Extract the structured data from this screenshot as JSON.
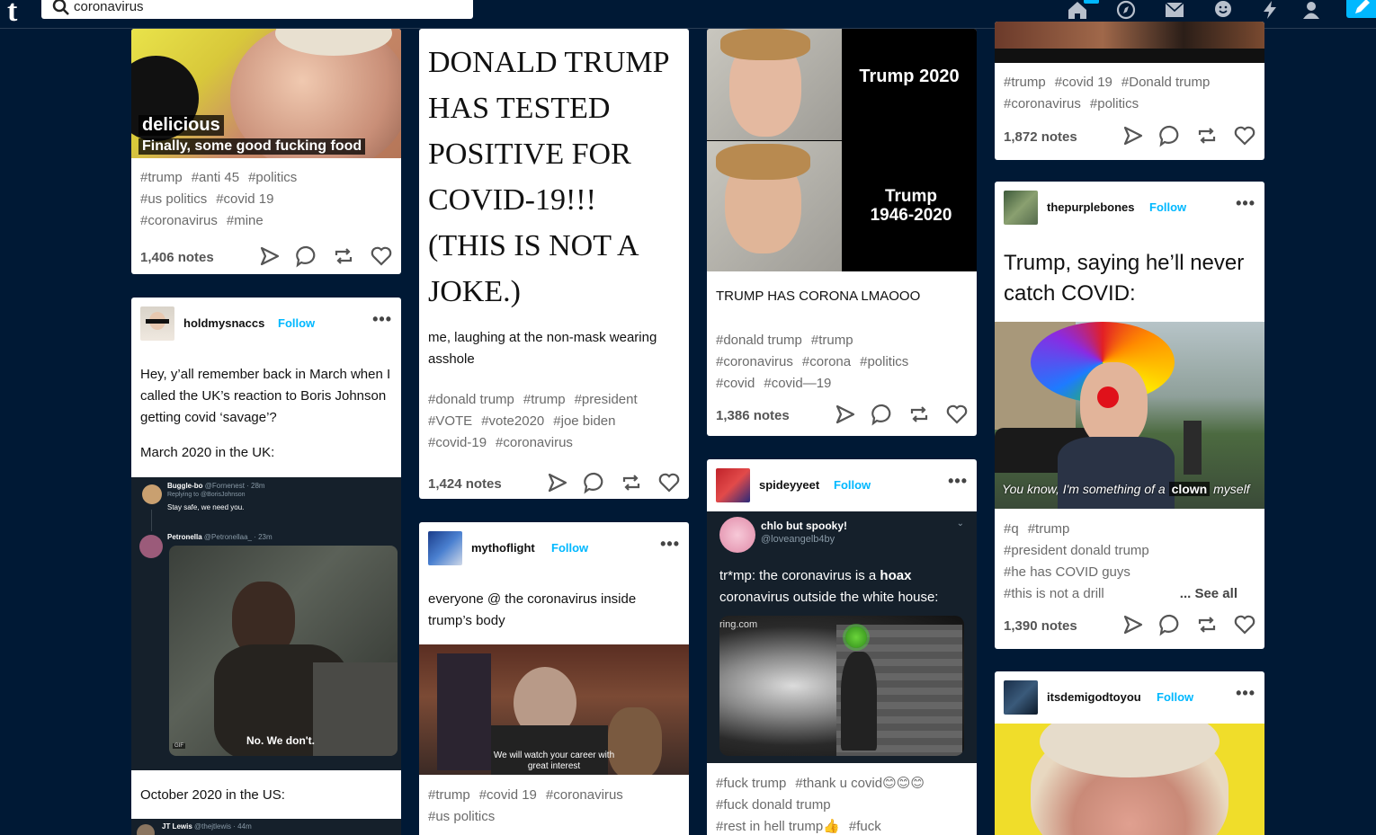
{
  "app": {
    "logo": "t",
    "search_value": "coronavirus"
  },
  "col1": {
    "post1": {
      "image_caption_1": "delicious",
      "image_caption_2": "Finally, some good fucking food",
      "tags": [
        "#trump",
        "#anti 45",
        "#politics",
        "#us politics",
        "#covid 19",
        "#coronavirus",
        "#mine"
      ],
      "notes": "1,406 notes"
    },
    "post2": {
      "username": "holdmysnaccs",
      "follow": "Follow",
      "text1": "Hey, y’all remember back in March when I called the UK’s reaction to Boris Johnson getting covid ‘savage’?",
      "text2": "March 2020 in the UK:",
      "tweet1_user": "Buggle-bo",
      "tweet1_handle": "@Fornenest · 28m",
      "tweet1_reply": "Replying to @BorisJohnson",
      "tweet1_text": "Stay safe, we need you.",
      "tweet2_user": "Petronella",
      "tweet2_handle": "@Petronellaa_ · 23m",
      "gif_caption": "No. We don't.",
      "gif_label": "GIF",
      "text3": "October 2020 in the US:",
      "tweet3_user": "JT Lewis",
      "tweet3_handle": "@thejtlewis · 44m"
    }
  },
  "col2": {
    "post1": {
      "headline": "DONALD TRUMP HAS TESTED POSITIVE FOR COVID-19!!! (THIS IS NOT A JOKE.)",
      "text": "me, laughing at the non-mask wearing asshole",
      "tags": [
        "#donald trump",
        "#trump",
        "#president",
        "#VOTE",
        "#vote2020",
        "#joe biden",
        "#covid-19",
        "#coronavirus"
      ],
      "notes": "1,424 notes"
    },
    "post2": {
      "username": "mythoflight",
      "follow": "Follow",
      "text": "everyone @ the coronavirus inside trump’s body",
      "image_caption": "We will watch your career with great interest",
      "tags": [
        "#trump",
        "#covid 19",
        "#coronavirus",
        "#us politics"
      ]
    }
  },
  "col3": {
    "post1": {
      "meme_top": "Trump 2020",
      "meme_bottom": "Trump 1946-2020",
      "text": "TRUMP HAS CORONA LMAOOO",
      "tags": [
        "#donald trump",
        "#trump",
        "#coronavirus",
        "#corona",
        "#politics",
        "#covid",
        "#covid—19"
      ],
      "notes": "1,386 notes"
    },
    "post2": {
      "username": "spideyyeet",
      "follow": "Follow",
      "reblog_user": "chlo but spooky!",
      "reblog_handle": "@loveangelb4by",
      "reblog_text_1": "tr*mp: the coronavirus is a ",
      "reblog_text_bold": "hoax",
      "reblog_text_2": "coronavirus outside the white house:",
      "ring_label": "ring.com",
      "tags": [
        "#fuck trump",
        "#thank u covid😊😊😊",
        "#fuck donald trump",
        "#rest in hell trump👍",
        "#fuck"
      ]
    }
  },
  "col4": {
    "post1": {
      "tags": [
        "#trump",
        "#covid 19",
        "#Donald trump",
        "#coronavirus",
        "#politics"
      ],
      "notes": "1,872 notes"
    },
    "post2": {
      "username": "thepurplebones",
      "follow": "Follow",
      "title": "Trump, saying he’ll never catch COVID:",
      "image_caption_a": "You know, I'm something of a ",
      "image_caption_b": "clown",
      "image_caption_c": " myself",
      "tags": [
        "#q",
        "#trump",
        "#president donald trump",
        "#he has COVID guys",
        "#this is not a drill"
      ],
      "see_all": "... See all",
      "notes": "1,390 notes"
    },
    "post3": {
      "username": "itsdemigodtoyou",
      "follow": "Follow"
    }
  },
  "colors": {
    "background": "#001935",
    "accent": "#00b8ff",
    "tag_gray": "#6b6b6b"
  }
}
